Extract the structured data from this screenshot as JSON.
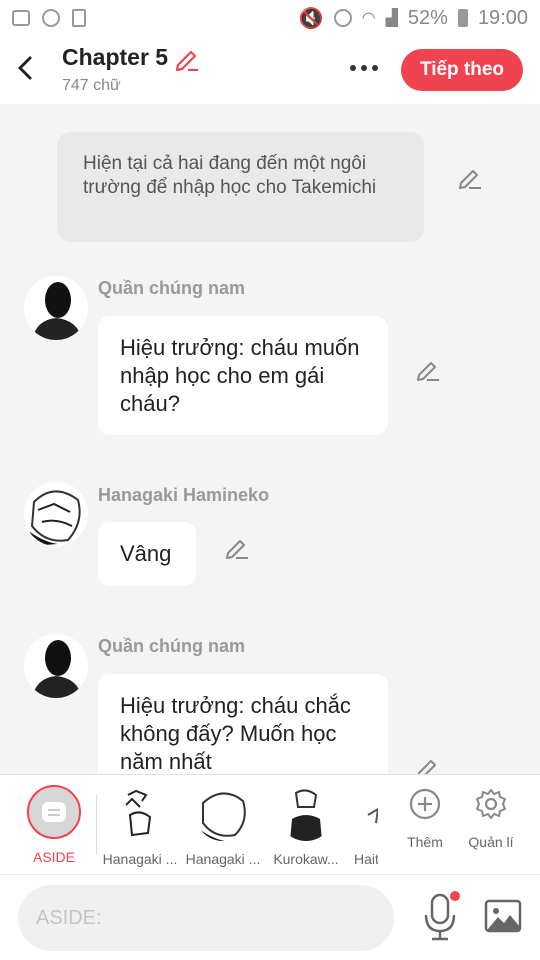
{
  "status_bar": {
    "battery": "52%",
    "time": "19:00"
  },
  "header": {
    "title": "Chapter 5",
    "subtitle": "747 chữ",
    "next_label": "Tiếp theo"
  },
  "messages": [
    {
      "type": "aside",
      "text": "Hiện tại cả hai đang đến một ngôi trường để nhập học cho Takemichi"
    },
    {
      "type": "character",
      "speaker": "Quần chúng nam",
      "text": "Hiệu trưởng: cháu muốn nhập học cho em gái cháu?"
    },
    {
      "type": "character",
      "speaker": "Hanagaki Hamineko",
      "text": "Vâng"
    },
    {
      "type": "character",
      "speaker": "Quần chúng nam",
      "text": "Hiệu trưởng: cháu chắc không đấy? Muốn học năm nhất"
    }
  ],
  "bottom_bar": {
    "aside_label": "ASIDE",
    "characters": [
      "Hanagaki ...",
      "Hanagaki ...",
      "Kurokaw...",
      "Hait"
    ],
    "add_label": "Thêm",
    "manage_label": "Quản lí"
  },
  "input": {
    "placeholder": "ASIDE:"
  },
  "colors": {
    "accent": "#f0434f",
    "background": "#f4f4f4",
    "aside_bubble": "#e9e9e9"
  }
}
